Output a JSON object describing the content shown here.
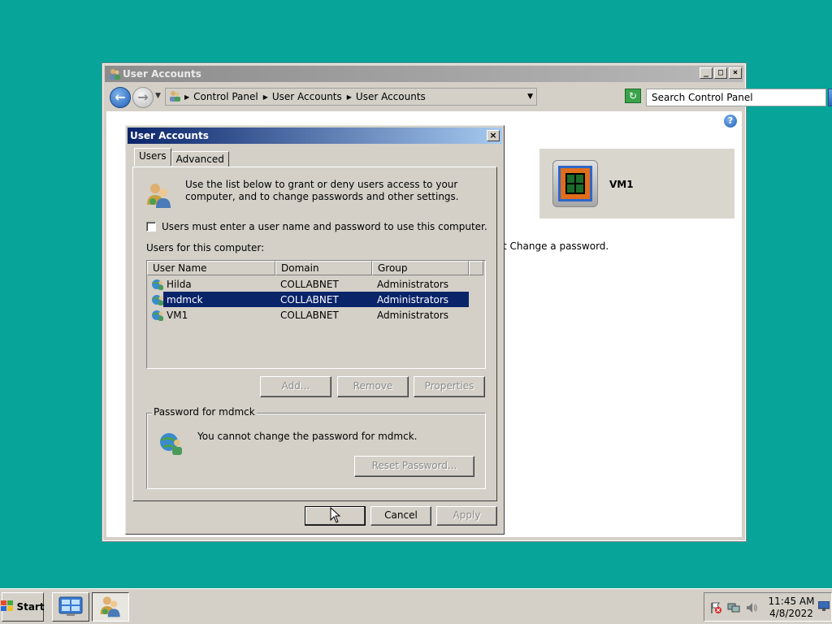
{
  "explorer": {
    "title": "User Accounts",
    "caption_buttons": [
      "_",
      "□",
      "×"
    ],
    "breadcrumbs": [
      "Control Panel",
      "User Accounts",
      "User Accounts"
    ],
    "search_placeholder": "Search Control Panel",
    "account_card_name": "VM1",
    "partial_link": "t Change a password."
  },
  "dialog": {
    "title": "User Accounts",
    "close": "×",
    "tabs": [
      "Users",
      "Advanced"
    ],
    "intro": "Use the list below to grant or deny users access to your computer, and to change passwords and other settings.",
    "checkbox_label": "Users must enter a user name and password to use this computer.",
    "checkbox_checked": false,
    "users_label": "Users for this computer:",
    "columns": [
      "User Name",
      "Domain",
      "Group"
    ],
    "rows": [
      {
        "name": "Hilda",
        "domain": "COLLABNET",
        "group": "Administrators"
      },
      {
        "name": "mdmck",
        "domain": "COLLABNET",
        "group": "Administrators"
      },
      {
        "name": "VM1",
        "domain": "COLLABNET",
        "group": "Administrators"
      }
    ],
    "selected_row": 1,
    "buttons": {
      "add": "Add...",
      "remove": "Remove",
      "properties": "Properties"
    },
    "password_group": {
      "legend": "Password for mdmck",
      "message": "You cannot change the password for mdmck.",
      "reset_button": "Reset Password..."
    },
    "footer": {
      "ok": "",
      "cancel": "Cancel",
      "apply": "Apply"
    }
  },
  "taskbar": {
    "start": "Start",
    "time": "11:45 AM",
    "date": "4/8/2022"
  },
  "colors": {
    "desktop": "#07a49a",
    "dialog_title": "#0a246a",
    "selection": "#0a246a"
  }
}
